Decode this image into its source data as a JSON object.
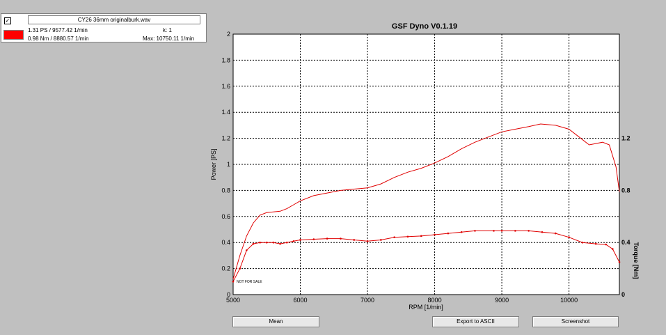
{
  "legend": {
    "checkbox": "✓",
    "filename": "CY26 36mm originalburk.wav",
    "power_line": "1.31 PS / 9577.42 1/min",
    "k_line": "k: 1",
    "torque_line": "0.98 Nm / 8880.57 1/min",
    "max_line": "Max: 10750.11 1/min",
    "swatch_color": "#ff0000"
  },
  "buttons": {
    "mean": "Mean",
    "export": "Export to ASCII",
    "screenshot": "Screenshot"
  },
  "watermark": "NOT FOR SALE",
  "chart_data": {
    "type": "line",
    "title": "GSF Dyno V0.1.19",
    "xlabel": "RPM [1/min]",
    "ylabel": "Power [PS]",
    "y2label": "Torque [Nm]",
    "xlim": [
      5000,
      10750
    ],
    "ylim": [
      0,
      2
    ],
    "y2lim": [
      0,
      2
    ],
    "x_ticks": [
      5000,
      6000,
      7000,
      8000,
      9000,
      10000
    ],
    "y_ticks": [
      "0",
      "0.2",
      "0.4",
      "0.6",
      "0.8",
      "1",
      "1.2",
      "1.4",
      "1.6",
      "1.8",
      "2"
    ],
    "y2_ticks": [
      "0",
      "0.4",
      "0.8",
      "1.2"
    ],
    "grid": true,
    "series": [
      {
        "name": "Power",
        "color": "#e00000",
        "points": [
          [
            5000,
            0.12
          ],
          [
            5100,
            0.3
          ],
          [
            5200,
            0.45
          ],
          [
            5300,
            0.55
          ],
          [
            5400,
            0.61
          ],
          [
            5500,
            0.63
          ],
          [
            5600,
            0.635
          ],
          [
            5700,
            0.64
          ],
          [
            5800,
            0.66
          ],
          [
            5900,
            0.69
          ],
          [
            6000,
            0.72
          ],
          [
            6200,
            0.76
          ],
          [
            6400,
            0.78
          ],
          [
            6600,
            0.8
          ],
          [
            6800,
            0.81
          ],
          [
            7000,
            0.82
          ],
          [
            7200,
            0.85
          ],
          [
            7400,
            0.9
          ],
          [
            7600,
            0.94
          ],
          [
            7800,
            0.97
          ],
          [
            8000,
            1.01
          ],
          [
            8200,
            1.06
          ],
          [
            8400,
            1.12
          ],
          [
            8600,
            1.17
          ],
          [
            8800,
            1.21
          ],
          [
            9000,
            1.25
          ],
          [
            9200,
            1.27
          ],
          [
            9400,
            1.29
          ],
          [
            9577,
            1.31
          ],
          [
            9800,
            1.3
          ],
          [
            10000,
            1.27
          ],
          [
            10150,
            1.21
          ],
          [
            10300,
            1.15
          ],
          [
            10400,
            1.16
          ],
          [
            10500,
            1.17
          ],
          [
            10600,
            1.15
          ],
          [
            10700,
            0.98
          ],
          [
            10750,
            0.79
          ]
        ]
      },
      {
        "name": "Torque",
        "color": "#e00000",
        "points": [
          [
            5000,
            0.1
          ],
          [
            5100,
            0.2
          ],
          [
            5200,
            0.34
          ],
          [
            5300,
            0.39
          ],
          [
            5400,
            0.4
          ],
          [
            5500,
            0.4
          ],
          [
            5600,
            0.4
          ],
          [
            5700,
            0.39
          ],
          [
            5800,
            0.4
          ],
          [
            5900,
            0.41
          ],
          [
            6000,
            0.42
          ],
          [
            6200,
            0.425
          ],
          [
            6400,
            0.43
          ],
          [
            6600,
            0.43
          ],
          [
            6800,
            0.42
          ],
          [
            7000,
            0.41
          ],
          [
            7200,
            0.42
          ],
          [
            7400,
            0.44
          ],
          [
            7600,
            0.445
          ],
          [
            7800,
            0.45
          ],
          [
            8000,
            0.46
          ],
          [
            8200,
            0.47
          ],
          [
            8400,
            0.48
          ],
          [
            8600,
            0.49
          ],
          [
            8880,
            0.49
          ],
          [
            9000,
            0.49
          ],
          [
            9200,
            0.49
          ],
          [
            9400,
            0.49
          ],
          [
            9600,
            0.48
          ],
          [
            9800,
            0.47
          ],
          [
            10000,
            0.44
          ],
          [
            10200,
            0.4
          ],
          [
            10400,
            0.39
          ],
          [
            10550,
            0.385
          ],
          [
            10650,
            0.35
          ],
          [
            10750,
            0.25
          ]
        ]
      }
    ]
  }
}
